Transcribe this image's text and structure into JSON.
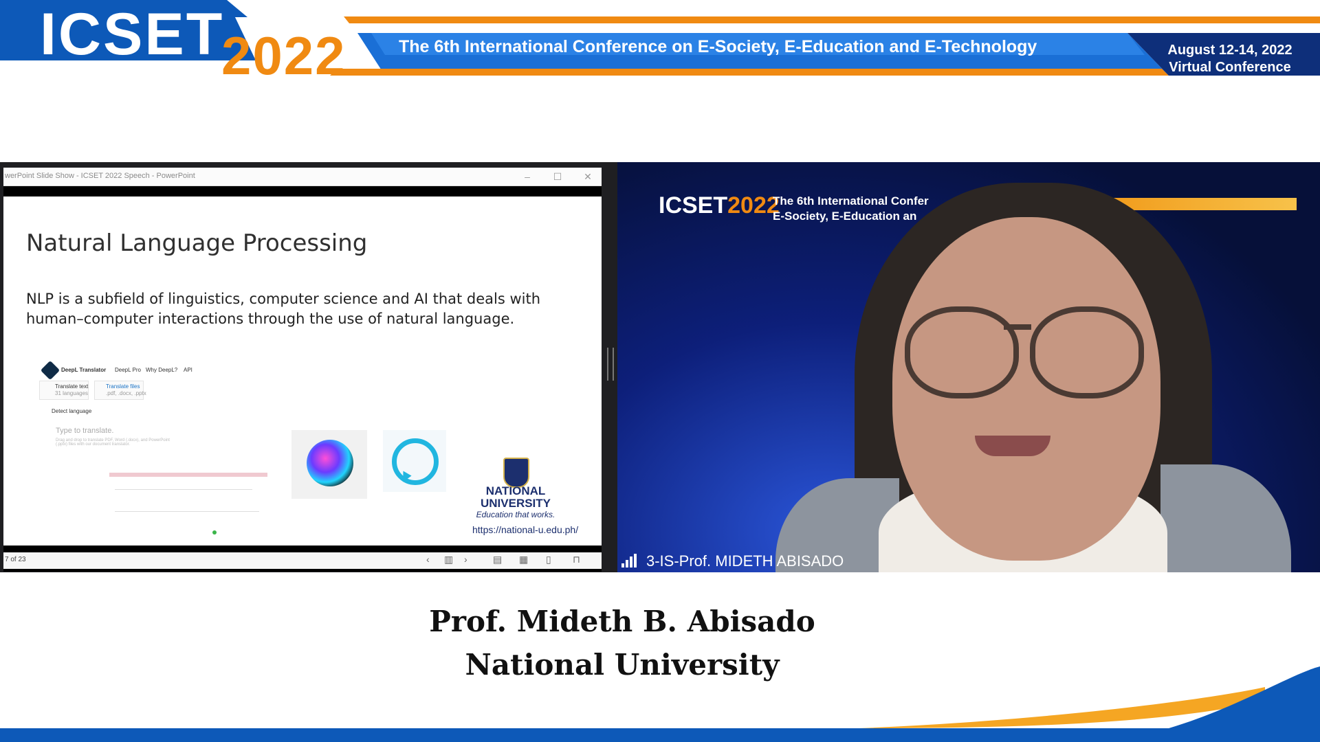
{
  "banner": {
    "logo_text": "ICSET",
    "logo_year": "2022",
    "conference_title": "The 6th International Conference on E-Society, E-Education and E-Technology",
    "dates": "August 12-14, 2022",
    "mode": "Virtual Conference",
    "colors": {
      "blue": "#0d59b8",
      "orange": "#f08a12",
      "navy": "#0e2f7a"
    }
  },
  "powerpoint": {
    "window_title": "werPoint Slide Show  -  ICSET 2022 Speech - PowerPoint",
    "minimize_icon": "minimize-icon",
    "maximize_icon": "maximize-icon",
    "close_icon": "close-icon",
    "slide": {
      "heading": "Natural Language Processing",
      "body": "NLP is a subfield of linguistics, computer science and AI that deals with human–computer interactions through the use of natural language.",
      "translator": {
        "brand": "DeepL Translator",
        "nav": [
          "DeepL Pro",
          "Why DeepL?",
          "API"
        ],
        "tab_text": "Translate text",
        "tab_text_sub": "31 languages",
        "tab_files": "Translate files",
        "tab_files_sub": ".pdf, .docx, .pptx",
        "detect": "Detect language",
        "placeholder": "Type to translate.",
        "hint": "Drag and drop to translate PDF, Word (.docx), and PowerPoint (.pptx) files with our document translator."
      },
      "university": {
        "name_line1": "NATIONAL",
        "name_line2": "UNIVERSITY",
        "tagline": "Education that works.",
        "url": "https://national-u.edu.ph/"
      },
      "assistant_icons": [
        "siri-icon",
        "alexa-icon"
      ]
    },
    "status": {
      "slide_count": "7 of 23",
      "controls": [
        "prev-icon",
        "menu-icon",
        "next-icon",
        "normal-view-icon",
        "slide-sorter-icon",
        "reading-view-icon",
        "slideshow-icon"
      ]
    }
  },
  "camera": {
    "backdrop_logo": "ICSET",
    "backdrop_logo_year": "2022",
    "backdrop_title_line1": "The 6th International Confer",
    "backdrop_title_line2": "E-Society, E-Education an",
    "participant_label": "3-IS-Prof. MIDETH ABISADO"
  },
  "caption": {
    "name": "Prof. Mideth B. Abisado",
    "affiliation": "National University"
  }
}
